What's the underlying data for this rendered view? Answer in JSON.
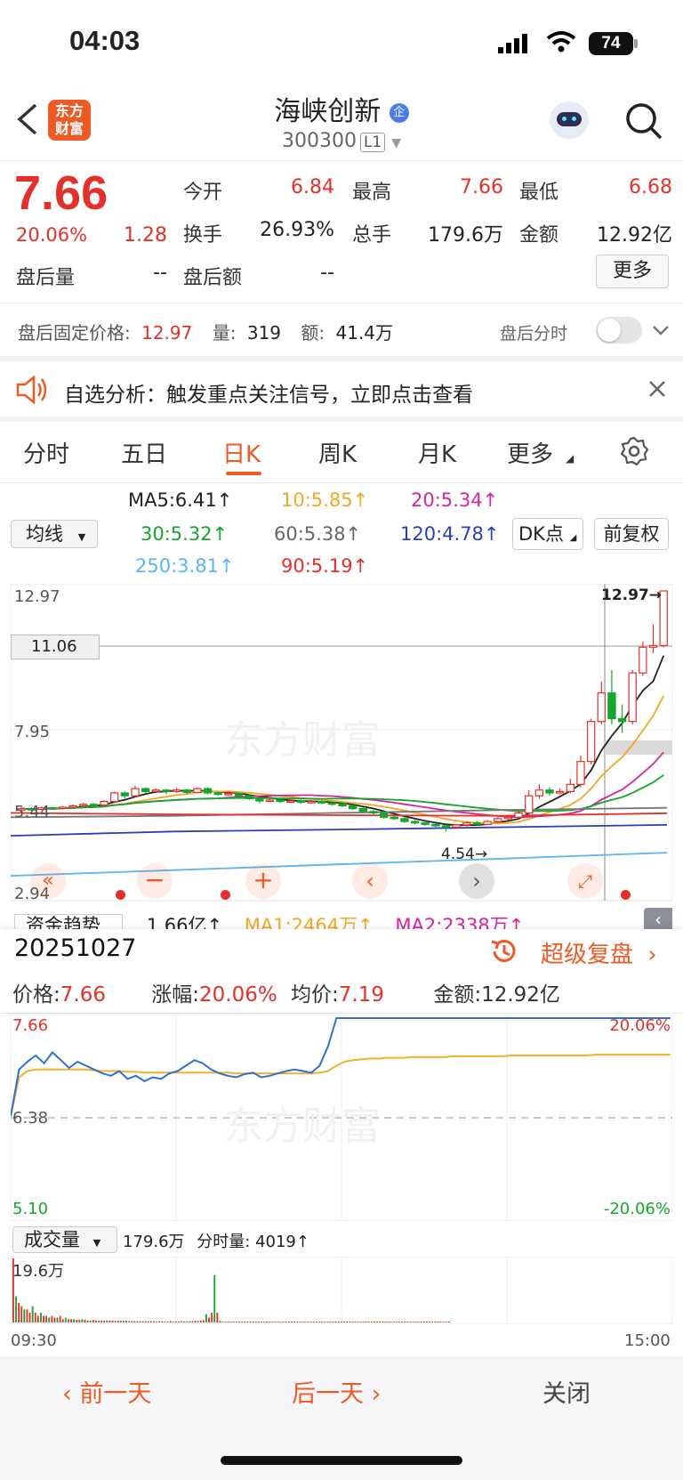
{
  "status_bar": {
    "time": "04:03",
    "battery": "74"
  },
  "header": {
    "title": "海峡创新",
    "code": "300300",
    "level": "L1"
  },
  "quote": {
    "price": "7.66",
    "change_pct": "20.06%",
    "change": "1.28",
    "open_label": "今开",
    "open": "6.84",
    "high_label": "最高",
    "high": "7.66",
    "low_label": "最低",
    "low": "6.68",
    "turnover_label": "换手",
    "turnover": "26.93%",
    "volume_label": "总手",
    "volume": "179.6万",
    "amount_label": "金额",
    "amount": "12.92亿",
    "after_vol_label": "盘后量",
    "after_vol": "--",
    "after_amt_label": "盘后额",
    "after_amt": "--",
    "more_label": "更多"
  },
  "after_hours": {
    "label": "盘后固定价格:",
    "price": "12.97",
    "qty_label": "量:",
    "qty": "319",
    "amt_label": "额:",
    "amt": "41.4万",
    "toggle_label": "盘后分时"
  },
  "notice": {
    "text": "自选分析：触发重点关注信号，立即点击查看"
  },
  "tabs": [
    "分时",
    "五日",
    "日K",
    "周K",
    "月K",
    "更多"
  ],
  "active_tab": "日K",
  "ma_panel": {
    "selector": "均线",
    "ma5": "MA5:6.41↑",
    "ma10": "10:5.85↑",
    "ma20": "20:5.34↑",
    "ma30": "30:5.32↑",
    "ma60": "60:5.38↑",
    "ma120": "120:4.78↑",
    "ma250": "250:3.81↑",
    "ma90": "90:5.19↑",
    "dk_button": "DK点",
    "fq_button": "前复权",
    "colors": {
      "ma5": "#222222",
      "ma10": "#f5a623",
      "ma20": "#d6249f",
      "ma30": "#13a72b",
      "ma60": "#777777",
      "ma120": "#2a3fb8",
      "ma250": "#5ab4f5",
      "ma90": "#e5302a"
    }
  },
  "kline": {
    "y_ticks": [
      "12.97",
      "11.06",
      "7.95",
      "5.44",
      "2.94"
    ],
    "max_label": "12.97→",
    "min_label": "4.54→",
    "watermark": "东方财富",
    "candles": [
      [
        5.3,
        5.35,
        5.2,
        5.4
      ],
      [
        5.35,
        5.32,
        5.28,
        5.4
      ],
      [
        5.32,
        5.38,
        5.3,
        5.42
      ],
      [
        5.38,
        5.36,
        5.3,
        5.4
      ],
      [
        5.36,
        5.4,
        5.33,
        5.45
      ],
      [
        5.4,
        5.45,
        5.38,
        5.5
      ],
      [
        5.45,
        5.5,
        5.4,
        5.55
      ],
      [
        5.5,
        5.48,
        5.42,
        5.55
      ],
      [
        5.48,
        5.6,
        5.45,
        5.65
      ],
      [
        5.6,
        5.9,
        5.55,
        5.95
      ],
      [
        5.9,
        5.8,
        5.7,
        5.95
      ],
      [
        5.8,
        6.05,
        5.75,
        6.15
      ],
      [
        6.05,
        5.95,
        5.9,
        6.1
      ],
      [
        5.95,
        6.0,
        5.9,
        6.05
      ],
      [
        6.0,
        5.95,
        5.85,
        6.05
      ],
      [
        5.95,
        6.0,
        5.9,
        6.08
      ],
      [
        6.0,
        5.92,
        5.85,
        6.05
      ],
      [
        5.92,
        6.05,
        5.88,
        6.1
      ],
      [
        6.05,
        5.9,
        5.85,
        6.1
      ],
      [
        5.9,
        5.85,
        5.8,
        5.95
      ],
      [
        5.85,
        5.88,
        5.8,
        5.95
      ],
      [
        5.88,
        5.8,
        5.75,
        5.92
      ],
      [
        5.8,
        5.7,
        5.65,
        5.85
      ],
      [
        5.7,
        5.62,
        5.55,
        5.75
      ],
      [
        5.62,
        5.65,
        5.58,
        5.7
      ],
      [
        5.65,
        5.6,
        5.55,
        5.7
      ],
      [
        5.6,
        5.62,
        5.55,
        5.68
      ],
      [
        5.62,
        5.58,
        5.52,
        5.66
      ],
      [
        5.58,
        5.6,
        5.52,
        5.65
      ],
      [
        5.6,
        5.55,
        5.5,
        5.64
      ],
      [
        5.55,
        5.52,
        5.45,
        5.6
      ],
      [
        5.52,
        5.45,
        5.4,
        5.58
      ],
      [
        5.45,
        5.35,
        5.3,
        5.5
      ],
      [
        5.35,
        5.25,
        5.2,
        5.4
      ],
      [
        5.25,
        5.2,
        5.1,
        5.3
      ],
      [
        5.2,
        5.05,
        5.0,
        5.25
      ],
      [
        5.05,
        5.0,
        4.95,
        5.1
      ],
      [
        5.0,
        4.9,
        4.85,
        5.05
      ],
      [
        4.9,
        4.85,
        4.8,
        4.95
      ],
      [
        4.85,
        4.8,
        4.75,
        4.92
      ],
      [
        4.8,
        4.75,
        4.65,
        4.85
      ],
      [
        4.75,
        4.7,
        4.54,
        4.8
      ],
      [
        4.7,
        4.78,
        4.65,
        4.82
      ],
      [
        4.78,
        4.85,
        4.72,
        4.9
      ],
      [
        4.85,
        4.8,
        4.75,
        4.92
      ],
      [
        4.8,
        4.9,
        4.78,
        4.95
      ],
      [
        4.9,
        5.0,
        4.85,
        5.05
      ],
      [
        5.0,
        5.05,
        4.95,
        5.1
      ],
      [
        5.05,
        5.2,
        5.0,
        5.3
      ],
      [
        5.2,
        5.8,
        5.15,
        6.0
      ],
      [
        5.8,
        6.0,
        5.7,
        6.2
      ],
      [
        6.0,
        5.9,
        5.8,
        6.1
      ],
      [
        5.9,
        5.95,
        5.85,
        6.05
      ],
      [
        5.95,
        6.2,
        5.9,
        6.4
      ],
      [
        6.2,
        7.0,
        6.1,
        7.2
      ],
      [
        7.0,
        8.4,
        6.9,
        8.5
      ],
      [
        8.4,
        9.4,
        8.3,
        9.8
      ],
      [
        9.4,
        8.5,
        8.3,
        10.2
      ],
      [
        8.5,
        8.4,
        8.0,
        9.0
      ],
      [
        8.4,
        10.1,
        8.3,
        10.2
      ],
      [
        10.1,
        11.0,
        10.0,
        11.2
      ],
      [
        11.0,
        11.06,
        10.8,
        11.8
      ],
      [
        11.06,
        12.97,
        11.0,
        12.97
      ]
    ]
  },
  "fund_flow": {
    "selector": "资金趋势",
    "value": "1.66亿↑",
    "ma1": "MA1:2464万↑",
    "ma2": "MA2:2338万↑"
  },
  "detail": {
    "date": "20251027",
    "replay": "超级复盘",
    "price_label": "价格:",
    "price": "7.66",
    "pct_label": "涨幅:",
    "pct": "20.06%",
    "avg_label": "均价:",
    "avg": "7.19",
    "amt_label": "金额:",
    "amt": "12.92亿"
  },
  "intraday": {
    "top": "7.66",
    "mid": "6.38",
    "bottom": "5.10",
    "top_pct": "20.06%",
    "bottom_pct": "-20.06%",
    "price": [
      6.4,
      7.0,
      7.1,
      7.18,
      7.08,
      7.22,
      7.12,
      7.02,
      7.1,
      7.05,
      7.0,
      6.95,
      6.92,
      6.98,
      6.88,
      6.92,
      6.85,
      6.9,
      6.88,
      6.95,
      6.98,
      7.05,
      7.12,
      7.08,
      7.0,
      6.95,
      6.92,
      6.9,
      6.94,
      6.96,
      6.9,
      6.92,
      6.95,
      6.98,
      7.0,
      6.98,
      6.96,
      7.05,
      7.3,
      7.66,
      7.66,
      7.66,
      7.66,
      7.66,
      7.66,
      7.66,
      7.66,
      7.66,
      7.66,
      7.66,
      7.66,
      7.66,
      7.66,
      7.66,
      7.66,
      7.66,
      7.66,
      7.66,
      7.66,
      7.66,
      7.66,
      7.66,
      7.66,
      7.66,
      7.66,
      7.66,
      7.66,
      7.66,
      7.66,
      7.66,
      7.66,
      7.66,
      7.66,
      7.66,
      7.66,
      7.66,
      7.66,
      7.66,
      7.66,
      7.66
    ],
    "avg": [
      6.4,
      6.9,
      6.98,
      7.0,
      7.0,
      7.0,
      7.0,
      7.0,
      7.0,
      7.0,
      6.99,
      6.98,
      6.98,
      6.98,
      6.97,
      6.97,
      6.96,
      6.96,
      6.96,
      6.96,
      6.96,
      6.96,
      6.96,
      6.96,
      6.96,
      6.96,
      6.96,
      6.95,
      6.95,
      6.95,
      6.95,
      6.95,
      6.95,
      6.95,
      6.95,
      6.95,
      6.95,
      6.96,
      6.98,
      7.05,
      7.1,
      7.12,
      7.13,
      7.14,
      7.14,
      7.15,
      7.15,
      7.15,
      7.16,
      7.16,
      7.16,
      7.16,
      7.16,
      7.17,
      7.17,
      7.17,
      7.17,
      7.17,
      7.17,
      7.17,
      7.18,
      7.18,
      7.18,
      7.18,
      7.18,
      7.18,
      7.18,
      7.18,
      7.18,
      7.18,
      7.19,
      7.19,
      7.19,
      7.19,
      7.19,
      7.19,
      7.19,
      7.19,
      7.19,
      7.19
    ]
  },
  "volume": {
    "selector": "成交量",
    "total": "179.6万",
    "tick_label": "分时量:",
    "tick": "4019↑",
    "max_label": "19.6万",
    "start": "09:30",
    "end": "15:00",
    "bars": [
      19.6,
      8,
      6,
      5,
      4,
      4,
      3,
      5,
      3,
      2,
      3,
      2,
      2,
      1.5,
      2,
      1.5,
      1.5,
      2,
      1,
      1.5,
      1,
      1,
      1,
      0.8,
      0.8,
      1,
      0.8,
      0.6,
      0.6,
      0.8,
      0.6,
      0.6,
      0.6,
      0.6,
      0.6,
      0.6,
      0.6,
      0.5,
      0.5,
      0.5,
      0.5,
      0.5,
      0.4,
      0.4,
      0.4,
      0.4,
      0.4,
      0.4,
      0.4,
      0.4,
      0.4,
      0.4,
      0.3,
      0.4,
      0.4,
      0.3,
      0.3,
      0.4,
      0.3,
      0.3,
      0.3,
      0.4,
      0.3,
      0.3,
      0.4,
      0.4,
      0.5,
      0.5,
      0.6,
      0.7,
      2.5,
      1.5,
      3,
      14.5,
      3,
      0.5,
      0.3,
      0.3,
      0.3,
      0.2,
      0.2,
      0.2,
      0.2,
      0.2,
      0.2,
      0.2,
      0.2,
      0.2,
      0.2,
      0.2,
      0.15,
      0.15,
      0.15,
      0.15,
      0.15,
      0.15,
      0.15,
      0.15,
      0.15,
      0.15,
      0.15,
      0.15,
      0.15,
      0.15,
      0.15,
      0.15,
      0.1,
      0.1,
      0.1,
      0.1,
      0.1,
      0.1,
      0.1,
      0.1,
      0.1,
      0.1,
      0.1,
      0.1,
      0.1,
      0.1,
      0.1,
      0.1,
      0.1,
      0.1,
      0.1,
      0.1,
      0.1,
      0.1,
      0.1,
      0.1,
      0.1,
      0.1,
      0.1,
      0.1,
      0.1,
      0.1,
      0.1,
      0.1,
      0.1,
      0.1,
      0.1,
      0.1,
      0.1,
      0.1,
      0.1,
      0.1,
      0.1,
      0.1,
      0.1,
      0.1,
      0.1,
      0.1,
      0.1,
      0.1,
      0.1,
      0.1,
      0.1,
      0.1,
      0.1
    ]
  },
  "footer": {
    "prev": "前一天",
    "next": "后一天",
    "close": "关闭"
  }
}
